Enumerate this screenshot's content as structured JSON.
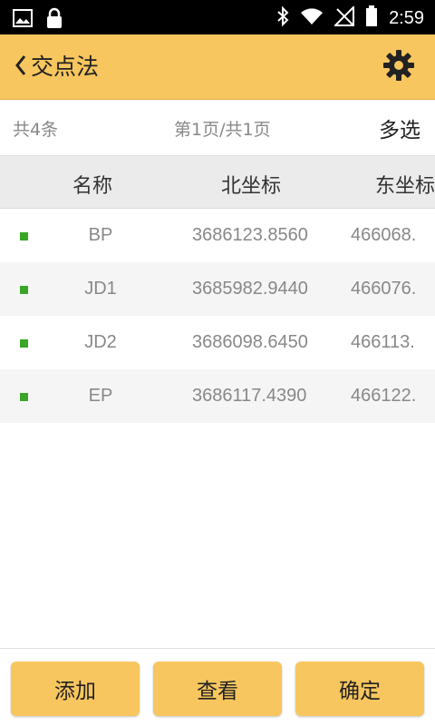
{
  "status_bar": {
    "time": "2:59",
    "icons": [
      "image-icon",
      "lock-icon",
      "bluetooth-icon",
      "wifi-icon",
      "no-signal-icon",
      "battery-icon"
    ]
  },
  "app_bar": {
    "title": "交点法",
    "back_icon": "chevron-left-icon",
    "settings_icon": "gear-icon"
  },
  "info": {
    "count": "共4条",
    "page": "第1页/共1页",
    "multi_select": "多选"
  },
  "table": {
    "headers": {
      "name": "名称",
      "north": "北坐标",
      "east": "东坐标"
    },
    "rows": [
      {
        "name": "BP",
        "north": "3686123.8560",
        "east": "466068."
      },
      {
        "name": "JD1",
        "north": "3685982.9440",
        "east": "466076."
      },
      {
        "name": "JD2",
        "north": "3686098.6450",
        "east": "466113."
      },
      {
        "name": "EP",
        "north": "3686117.4390",
        "east": "466122."
      }
    ]
  },
  "buttons": {
    "add": "添加",
    "view": "查看",
    "confirm": "确定"
  },
  "colors": {
    "accent": "#f7c65e",
    "marker": "#3aa526"
  }
}
